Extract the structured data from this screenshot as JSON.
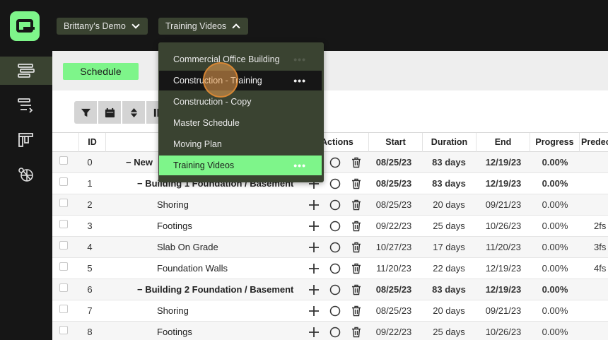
{
  "topbar": {
    "crumbs": [
      {
        "label": "Brittany's Demo"
      },
      {
        "label": "Training Videos"
      }
    ]
  },
  "sidebar": {
    "items": [
      {
        "icon": "gantt-icon",
        "active": true
      },
      {
        "icon": "task-list-icon",
        "active": false
      },
      {
        "icon": "board-icon",
        "active": false
      },
      {
        "icon": "global-icon",
        "active": false
      }
    ]
  },
  "subbar": {
    "schedule_label": "Schedule"
  },
  "toolbar": {
    "icons": [
      "filter-icon",
      "calendar-icon",
      "sort-icon",
      "columns-icon"
    ]
  },
  "grid": {
    "columns": [
      "ID",
      "Actions",
      "Start",
      "Duration",
      "End",
      "Progress",
      "Predec"
    ],
    "rows": [
      {
        "id": "0",
        "name": "New",
        "level": 0,
        "summary": true,
        "start": "08/25/23",
        "duration": "83 days",
        "end": "12/19/23",
        "progress": "0.00%",
        "pred": ""
      },
      {
        "id": "1",
        "name": "Building 1 Foundation / Basement",
        "level": 1,
        "summary": true,
        "start": "08/25/23",
        "duration": "83 days",
        "end": "12/19/23",
        "progress": "0.00%",
        "pred": ""
      },
      {
        "id": "2",
        "name": "Shoring",
        "level": 2,
        "summary": false,
        "start": "08/25/23",
        "duration": "20 days",
        "end": "09/21/23",
        "progress": "0.00%",
        "pred": ""
      },
      {
        "id": "3",
        "name": "Footings",
        "level": 2,
        "summary": false,
        "start": "09/22/23",
        "duration": "25 days",
        "end": "10/26/23",
        "progress": "0.00%",
        "pred": "2fs"
      },
      {
        "id": "4",
        "name": "Slab On Grade",
        "level": 2,
        "summary": false,
        "start": "10/27/23",
        "duration": "17 days",
        "end": "11/20/23",
        "progress": "0.00%",
        "pred": "3fs"
      },
      {
        "id": "5",
        "name": "Foundation Walls",
        "level": 2,
        "summary": false,
        "start": "11/20/23",
        "duration": "22 days",
        "end": "12/19/23",
        "progress": "0.00%",
        "pred": "4fs"
      },
      {
        "id": "6",
        "name": "Building 2 Foundation / Basement",
        "level": 1,
        "summary": true,
        "start": "08/25/23",
        "duration": "83 days",
        "end": "12/19/23",
        "progress": "0.00%",
        "pred": ""
      },
      {
        "id": "7",
        "name": "Shoring",
        "level": 2,
        "summary": false,
        "start": "08/25/23",
        "duration": "20 days",
        "end": "09/21/23",
        "progress": "0.00%",
        "pred": ""
      },
      {
        "id": "8",
        "name": "Footings",
        "level": 2,
        "summary": false,
        "start": "09/22/23",
        "duration": "25 days",
        "end": "10/26/23",
        "progress": "0.00%",
        "pred": ""
      }
    ]
  },
  "dropdown": {
    "items": [
      {
        "label": "Commercial Office Building",
        "dots": "•••",
        "state": "normal"
      },
      {
        "label": "Construction - Training",
        "dots": "•••",
        "state": "hover"
      },
      {
        "label": "Construction - Copy",
        "dots": "",
        "state": "normal"
      },
      {
        "label": "Master Schedule",
        "dots": "",
        "state": "normal"
      },
      {
        "label": "Moving Plan",
        "dots": "",
        "state": "normal"
      },
      {
        "label": "Training Videos",
        "dots": "•••",
        "state": "selected"
      }
    ]
  },
  "colors": {
    "accent": "#7ef58a",
    "dark": "#161616",
    "olive": "#3a4331"
  }
}
